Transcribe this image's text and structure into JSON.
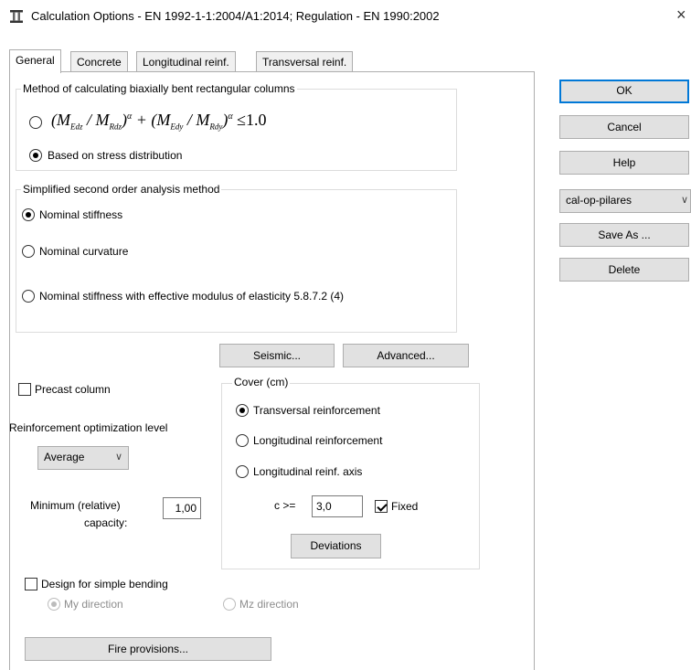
{
  "window": {
    "title": "Calculation Options - EN 1992-1-1:2004/A1:2014;  Regulation - EN 1990:2002",
    "close": "×",
    "icon": "column-app-icon"
  },
  "tabs": [
    "General",
    "Concrete",
    "Longitudinal reinf.",
    "Transversal reinf."
  ],
  "biaxial": {
    "legend": "Method of calculating biaxially bent rectangular columns",
    "option_formula": "(M_Edz / M_Rdz)^α + (M_Edy / M_Rdy)^α ≤ 1.0",
    "formula_tail": "≤1.0",
    "option_stress": "Based on stress distribution",
    "selected": "stress"
  },
  "second_order": {
    "legend": "Simplified second order analysis method",
    "options": [
      "Nominal stiffness",
      "Nominal curvature",
      "Nominal stiffness with effective modulus of elasticity 5.8.7.2 (4)"
    ],
    "selected_index": 0
  },
  "buttons": {
    "seismic": "Seismic...",
    "advanced": "Advanced...",
    "deviations": "Deviations",
    "fire": "Fire provisions...",
    "ok": "OK",
    "cancel": "Cancel",
    "help": "Help",
    "save_as": "Save As ...",
    "delete": "Delete"
  },
  "precast": {
    "label": "Precast column",
    "checked": false
  },
  "optimization": {
    "label": "Reinforcement optimization level",
    "value": "Average"
  },
  "min_capacity": {
    "label_line1": "Minimum (relative)",
    "label_line2": "capacity:",
    "value": "1,00"
  },
  "cover": {
    "legend": "Cover (cm)",
    "options": [
      "Transversal reinforcement",
      "Longitudinal reinforcement",
      "Longitudinal reinf. axis"
    ],
    "selected_index": 0,
    "c_label": "c >=",
    "c_value": "3,0",
    "fixed_label": "Fixed",
    "fixed_checked": true
  },
  "simple_bending": {
    "label": "Design for simple bending",
    "checked": false,
    "my": "My direction",
    "mz": "Mz direction"
  },
  "profile": {
    "value": "cal-op-pilares"
  }
}
